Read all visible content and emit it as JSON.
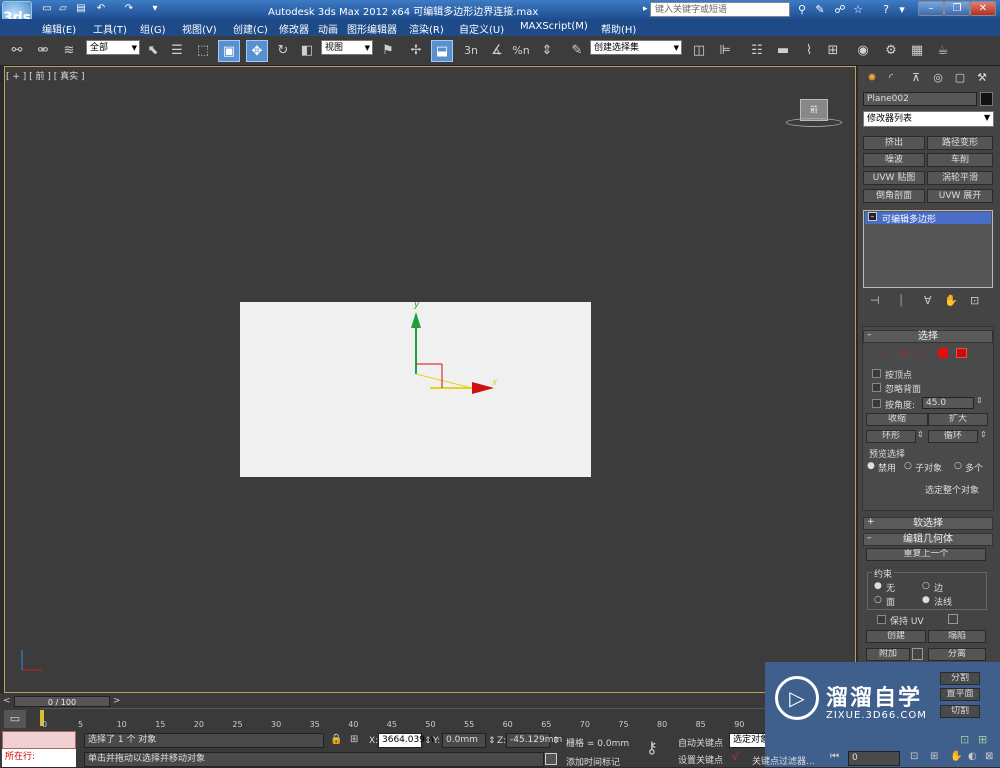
{
  "title_bar": {
    "app_logo": "3ds",
    "title": "Autodesk 3ds Max  2012 x64      可编辑多边形边界连接.max",
    "search_placeholder": "键入关键字或短语"
  },
  "menu": [
    "编辑(E)",
    "工具(T)",
    "组(G)",
    "视图(V)",
    "创建(C)",
    "修改器",
    "动画",
    "图形编辑器",
    "渲染(R)",
    "自定义(U)",
    "MAXScript(M)",
    "帮助(H)"
  ],
  "toolbar": {
    "selection_filter": "全部",
    "ref_coord": "视图",
    "named_selection": "创建选择集",
    "snap_label": "3n",
    "angle_snap": "%n"
  },
  "viewport": {
    "label": "[ + ] [ 前 ] [ 真实 ]",
    "viewcube_label": "前",
    "gizmo_y": "y",
    "gizmo_x": "x"
  },
  "command_panel": {
    "object_name": "Plane002",
    "modifier_list": "修改器列表",
    "modifier_buttons": [
      "挤出",
      "路径变形",
      "噪波",
      "车削",
      "UVW 贴图",
      "涡轮平滑",
      "倒角剖面",
      "UVW 展开"
    ],
    "stack_item": "可编辑多边形",
    "selection_rollup": "选择",
    "by_vertex": "按顶点",
    "ignore_backfacing": "忽略背面",
    "by_angle": "按角度:",
    "angle_value": "45.0",
    "shrink": "收缩",
    "grow": "扩大",
    "ring": "环形",
    "loop": "循环",
    "preview_selection": "预览选择",
    "preview_off": "禁用",
    "preview_subobj": "子对象",
    "preview_multi": "多个",
    "select_whole": "选定整个对象",
    "soft_selection": "软选择",
    "edit_geometry": "编辑几何体",
    "repeat_last": "重复上一个",
    "constraints": "约束",
    "c_none": "无",
    "c_edge": "边",
    "c_face": "面",
    "c_normal": "法线",
    "preserve_uv": "保持 UV",
    "create": "创建",
    "collapse": "塌陷",
    "attach": "附加",
    "detach": "分离",
    "slice_plane_partial": "分割",
    "reset_plane_partial": "置平面",
    "cut_partial": "切割"
  },
  "bottom": {
    "time_slider": "0 / 100",
    "ruler_ticks": [
      "5",
      "10",
      "15",
      "20",
      "25",
      "30",
      "35",
      "40",
      "45",
      "50",
      "55",
      "60",
      "65",
      "70",
      "75",
      "80",
      "85",
      "90"
    ],
    "ruler_zero": "0",
    "current_layer": "所在行:",
    "status_line1": "选择了 1 个 对象",
    "status_line2": "单击并拖动以选择并移动对象",
    "x_label": "X:",
    "x_value": "3664.039m",
    "y_label": "Y:",
    "y_value": "0.0mm",
    "z_label": "Z:",
    "z_value": "-45.129mm",
    "grid": "栅格 = 0.0mm",
    "add_time_tag": "添加时间标记",
    "auto_key": "自动关键点",
    "selected_field": "选定对象",
    "set_key": "设置关键点",
    "key_filters": "关键点过滤器...",
    "frame_value": "0"
  },
  "watermark": {
    "brand": "溜溜自学",
    "url": "ZIXUE.3D66.COM"
  },
  "colors": {
    "title_blue": "#2a5aa0",
    "viewport_bg": "#3c3c3c",
    "plane": "#f0f0f0",
    "axis_y": "#1aa33a",
    "axis_x": "#d01010",
    "highlight": "#4a6ec8"
  },
  "icons": [
    "app-logo",
    "new-icon",
    "open-icon",
    "save-icon",
    "undo-icon",
    "redo-icon",
    "link-icon",
    "unlink-icon",
    "bind-icon",
    "select-icon",
    "select-by-name-icon",
    "rect-select-icon",
    "window-crossing-icon",
    "move-icon",
    "rotate-icon",
    "scale-icon",
    "pivot-icon",
    "snap-icon",
    "mirror-icon",
    "align-icon",
    "layer-icon",
    "curve-editor-icon",
    "schematic-icon",
    "material-editor-icon",
    "render-setup-icon",
    "render-icon",
    "render-frame-icon"
  ]
}
